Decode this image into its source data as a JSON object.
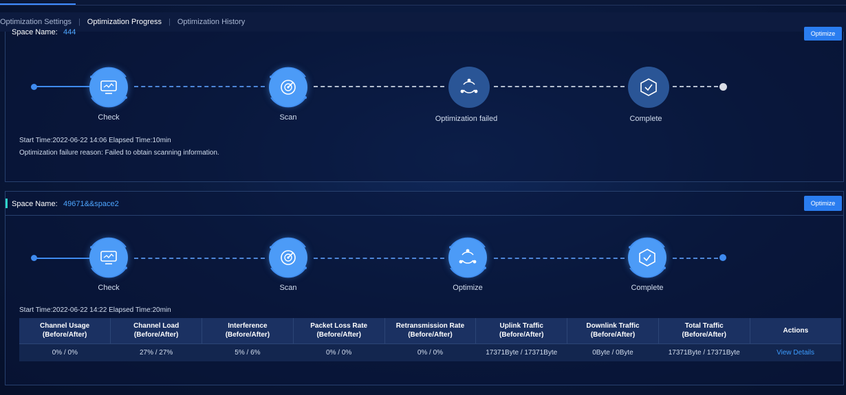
{
  "tabs": {
    "settings": "Optimization Settings",
    "separator": "|",
    "progress": "Optimization Progress",
    "history": "Optimization History"
  },
  "panels": [
    {
      "space_label": "Space Name:",
      "space_value": "444",
      "optimize_button": "Optimize",
      "steps": [
        "Check",
        "Scan",
        "Optimization failed",
        "Complete"
      ],
      "start_info": "Start Time:2022-06-22 14:06 Elapsed Time:10min",
      "failure_reason": "Optimization failure reason: Failed to obtain scanning information."
    },
    {
      "space_label": "Space Name:",
      "space_value": "49671&&space2",
      "optimize_button": "Optimize",
      "steps": [
        "Check",
        "Scan",
        "Optimize",
        "Complete"
      ],
      "start_info": "Start Time:2022-06-22 14:22 Elapsed Time:20min",
      "table": {
        "headers": [
          [
            "Channel Usage",
            "(Before/After)"
          ],
          [
            "Channel Load",
            "(Before/After)"
          ],
          [
            "Interference",
            "(Before/After)"
          ],
          [
            "Packet Loss Rate",
            "(Before/After)"
          ],
          [
            "Retransmission Rate",
            "(Before/After)"
          ],
          [
            "Uplink Traffic",
            "(Before/After)"
          ],
          [
            "Downlink Traffic",
            "(Before/After)"
          ],
          [
            "Total Traffic",
            "(Before/After)"
          ],
          [
            "Actions",
            ""
          ]
        ],
        "row": [
          "0% / 0%",
          "27% / 27%",
          "5% / 6%",
          "0% / 0%",
          "0% / 0%",
          "17371Byte / 17371Byte",
          "0Byte / 0Byte",
          "17371Byte / 17371Byte",
          "View Details"
        ]
      }
    }
  ]
}
